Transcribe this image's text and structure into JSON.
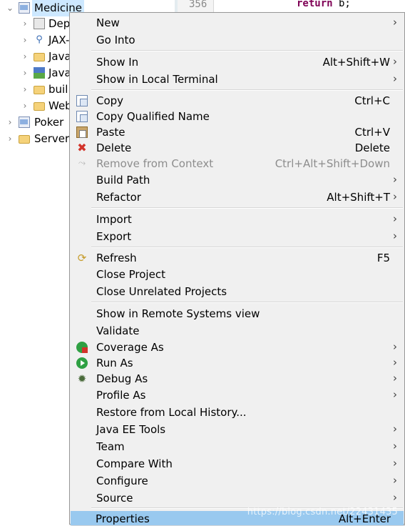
{
  "explorer": {
    "project_name": "Medicine",
    "children": [
      {
        "label": "Dep"
      },
      {
        "label": "JAX-"
      },
      {
        "label": "Java"
      },
      {
        "label": "Java"
      },
      {
        "label": "buil"
      },
      {
        "label": "Web"
      }
    ],
    "siblings": [
      {
        "label": "Poker"
      },
      {
        "label": "Servers"
      }
    ]
  },
  "editor": {
    "line_number": "356",
    "code_keyword": "return",
    "code_rest": " b;"
  },
  "menu": {
    "new": {
      "label": "New",
      "arrow": "›"
    },
    "go_into": {
      "label": "Go Into"
    },
    "show_in": {
      "label": "Show In",
      "shortcut": "Alt+Shift+W",
      "arrow": "›"
    },
    "show_in_terminal": {
      "label": "Show in Local Terminal",
      "arrow": "›"
    },
    "copy": {
      "label": "Copy",
      "shortcut": "Ctrl+C",
      "icon": "copy-icon"
    },
    "copy_qualified": {
      "label": "Copy Qualified Name",
      "icon": "copy-qualified-icon"
    },
    "paste": {
      "label": "Paste",
      "shortcut": "Ctrl+V",
      "icon": "paste-icon"
    },
    "delete": {
      "label": "Delete",
      "shortcut": "Delete",
      "icon": "delete-icon"
    },
    "remove_context": {
      "label": "Remove from Context",
      "shortcut": "Ctrl+Alt+Shift+Down",
      "icon": "remove-context-icon"
    },
    "build_path": {
      "label": "Build Path",
      "arrow": "›"
    },
    "refactor": {
      "label": "Refactor",
      "shortcut": "Alt+Shift+T",
      "arrow": "›"
    },
    "import": {
      "label": "Import",
      "arrow": "›"
    },
    "export": {
      "label": "Export",
      "arrow": "›"
    },
    "refresh": {
      "label": "Refresh",
      "shortcut": "F5",
      "icon": "refresh-icon"
    },
    "close_project": {
      "label": "Close Project"
    },
    "close_unrelated": {
      "label": "Close Unrelated Projects"
    },
    "show_remote": {
      "label": "Show in Remote Systems view"
    },
    "validate": {
      "label": "Validate"
    },
    "coverage_as": {
      "label": "Coverage As",
      "arrow": "›",
      "icon": "coverage-icon"
    },
    "run_as": {
      "label": "Run As",
      "arrow": "›",
      "icon": "run-icon"
    },
    "debug_as": {
      "label": "Debug As",
      "arrow": "›",
      "icon": "debug-icon"
    },
    "profile_as": {
      "label": "Profile As",
      "arrow": "›"
    },
    "restore_history": {
      "label": "Restore from Local History..."
    },
    "java_ee_tools": {
      "label": "Java EE Tools",
      "arrow": "›"
    },
    "team": {
      "label": "Team",
      "arrow": "›"
    },
    "compare_with": {
      "label": "Compare With",
      "arrow": "›"
    },
    "configure": {
      "label": "Configure",
      "arrow": "›"
    },
    "source": {
      "label": "Source",
      "arrow": "›"
    },
    "properties": {
      "label": "Properties",
      "shortcut": "Alt+Enter"
    }
  },
  "watermark": "https://blog.csdn.net/22431435",
  "colors": {
    "menu_bg": "#f0f0f0",
    "highlight": "#99c9ef",
    "selection": "#cde8ff",
    "keyword": "#7f0055"
  }
}
